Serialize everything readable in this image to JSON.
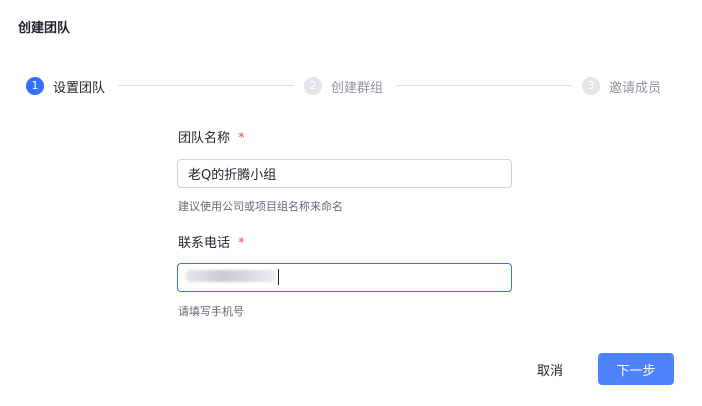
{
  "dialog": {
    "title": "创建团队"
  },
  "steps": [
    {
      "number": "1",
      "label": "设置团队",
      "active": true
    },
    {
      "number": "2",
      "label": "创建群组",
      "active": false
    },
    {
      "number": "3",
      "label": "邀请成员",
      "active": false
    }
  ],
  "form": {
    "team_name": {
      "label": "团队名称",
      "required_mark": "*",
      "value": "老Q的折腾小组",
      "hint": "建议使用公司或项目组名称来命名"
    },
    "phone": {
      "label": "联系电话",
      "required_mark": "*",
      "value": "",
      "hint": "请填写手机号"
    }
  },
  "buttons": {
    "cancel": "取消",
    "next": "下一步"
  },
  "colors": {
    "primary": "#3370ff",
    "primary_button": "#4e83fd",
    "required": "#f54a45",
    "inactive_step": "#e3e5e8"
  }
}
